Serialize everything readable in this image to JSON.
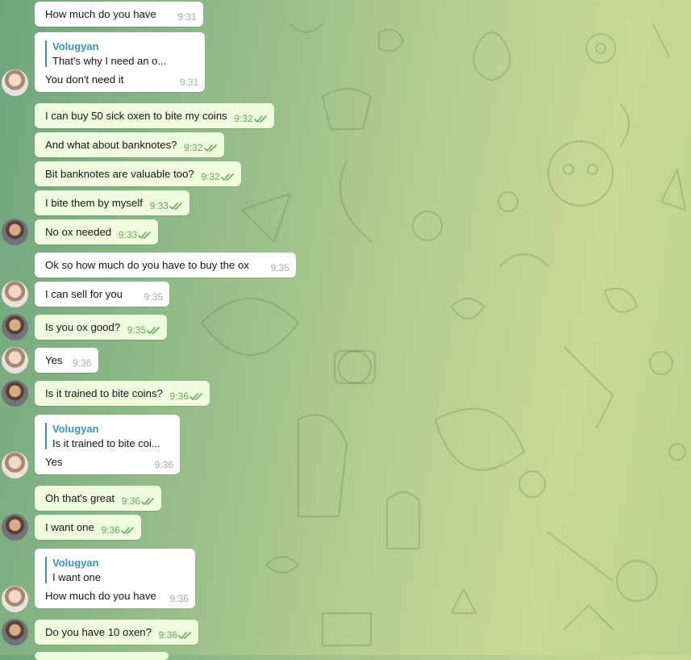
{
  "colors": {
    "incoming_bubble": "#ffffff",
    "outgoing_bubble": "#effdde",
    "reply_accent": "#3a90c7",
    "time_outgoing": "#5fad57",
    "time_incoming": "#a1aab3"
  },
  "messages": [
    {
      "dir": "in",
      "text": "How much do you have",
      "time": "9:31"
    },
    {
      "dir": "in",
      "reply_name": "Volugyan",
      "reply_text": "That's why I need an o...",
      "text": "You don't need it",
      "time": "9:31"
    },
    {
      "dir": "out",
      "text": "I can buy 50 sick oxen to bite my coins",
      "time": "9:32",
      "status": "read"
    },
    {
      "dir": "out",
      "text": "And what about banknotes?",
      "time": "9:32",
      "status": "read"
    },
    {
      "dir": "out",
      "text": "Bit banknotes are valuable too?",
      "time": "9:32",
      "status": "read"
    },
    {
      "dir": "out",
      "text": "I bite them by myself",
      "time": "9:33",
      "status": "read"
    },
    {
      "dir": "out",
      "text": "No ox needed",
      "time": "9:33",
      "status": "read"
    },
    {
      "dir": "in",
      "text": "Ok so how much do you have to buy the ox",
      "time": "9:35"
    },
    {
      "dir": "in",
      "text": "I can sell for you",
      "time": "9:35"
    },
    {
      "dir": "out",
      "text": "Is you ox good?",
      "time": "9:35",
      "status": "read"
    },
    {
      "dir": "in",
      "text": "Yes",
      "time": "9:36"
    },
    {
      "dir": "out",
      "text": "Is it trained to bite coins?",
      "time": "9:36",
      "status": "read"
    },
    {
      "dir": "in",
      "reply_name": "Volugyan",
      "reply_text": "Is it trained to bite coi...",
      "text": "Yes",
      "time": "9:36"
    },
    {
      "dir": "out",
      "text": "Oh that's great",
      "time": "9:36",
      "status": "read"
    },
    {
      "dir": "out",
      "text": "I want one",
      "time": "9:36",
      "status": "read"
    },
    {
      "dir": "in",
      "reply_name": "Volugyan",
      "reply_text": "I want one",
      "text": "How much do you have",
      "time": "9:36"
    },
    {
      "dir": "out",
      "text": "Do you have 10 oxen?",
      "time": "9:36",
      "status": "read"
    }
  ]
}
